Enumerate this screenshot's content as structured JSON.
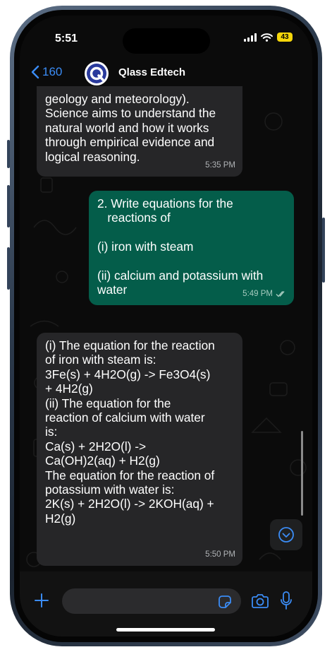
{
  "status_bar": {
    "time": "5:51",
    "battery": "43"
  },
  "header": {
    "back_count": "160",
    "title": "Qlass Edtech"
  },
  "messages": [
    {
      "direction": "in",
      "text": "geology and meteorology).\nScience aims to understand the\nnatural world and how it works\nthrough empirical evidence and\nlogical reasoning.",
      "time": "5:35 PM"
    },
    {
      "direction": "out",
      "text": "2. Write equations for the\n   reactions of\n\n(i) iron with steam\n\n(ii) calcium and potassium with\nwater",
      "time": "5:49 PM",
      "status": "read"
    },
    {
      "direction": "in",
      "text": "(i) The equation for the reaction\nof iron with steam is:\n3Fe(s) + 4H2O(g) -> Fe3O4(s)\n+ 4H2(g)\n(ii) The equation for the\nreaction of calcium with water\nis:\nCa(s) + 2H2O(l) ->\nCa(OH)2(aq) + H2(g)\nThe equation for the reaction of\npotassium with water is:\n2K(s) + 2H2O(l) -> 2KOH(aq) +\nH2(g)",
      "time": "5:50 PM"
    }
  ],
  "input_bar": {
    "text": ""
  },
  "icons": {
    "back": "chevron-left-icon",
    "avatar": "qlass-logo",
    "scroll_down": "chevron-down-circle-icon",
    "attach": "plus-icon",
    "sticker": "sticker-icon",
    "camera": "camera-icon",
    "microphone": "microphone-icon"
  },
  "colors": {
    "accent": "#3b8cf5",
    "outgoing_bubble": "#045d4a",
    "incoming_bubble": "#262628",
    "battery": "#f5d60a"
  }
}
